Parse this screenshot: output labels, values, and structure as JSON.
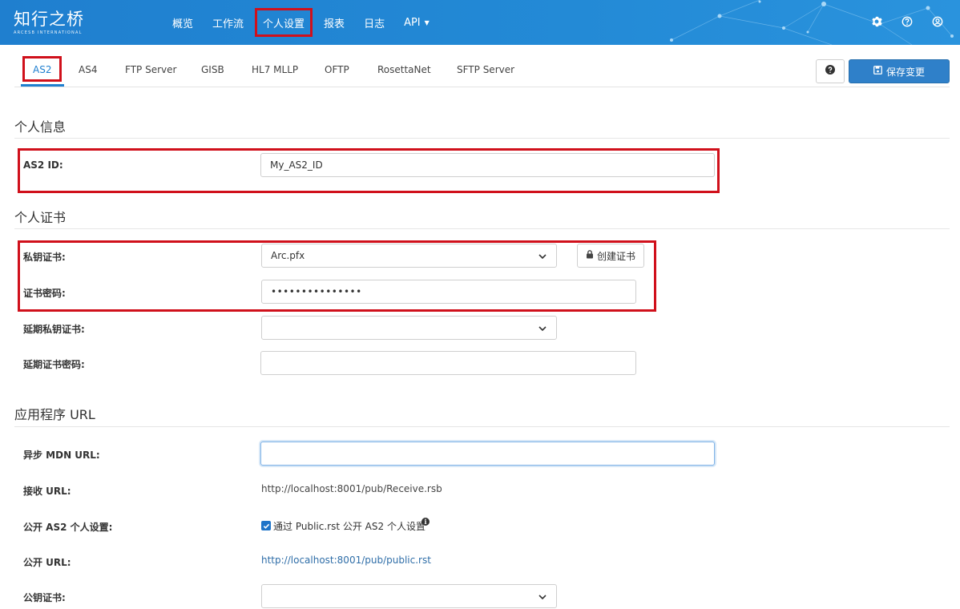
{
  "brand": {
    "name": "知行之桥",
    "tagline": "ARCESB INTERNATIONAL"
  },
  "nav": {
    "items": [
      "概览",
      "工作流",
      "个人设置",
      "报表",
      "日志",
      "API"
    ],
    "active": "个人设置"
  },
  "top_icons": [
    "gear-icon",
    "help-circle-icon",
    "user-circle-icon"
  ],
  "tabs": {
    "items": [
      "AS2",
      "AS4",
      "FTP Server",
      "GISB",
      "HL7 MLLP",
      "OFTP",
      "RosettaNet",
      "SFTP Server"
    ],
    "active": "AS2"
  },
  "toolbar": {
    "save_label": "保存变更"
  },
  "personal_info": {
    "title": "个人信息",
    "as2_id_label": "AS2 ID:",
    "as2_id_value": "My_AS2_ID"
  },
  "personal_cert": {
    "title": "个人证书",
    "private_cert_label": "私钥证书:",
    "private_cert_value": "Arc.pfx",
    "create_cert_label": "创建证书",
    "cert_password_label": "证书密码:",
    "cert_password_value": "•••••••••••••••",
    "future_private_cert_label": "延期私钥证书:",
    "future_private_cert_value": "",
    "future_cert_password_label": "延期证书密码:",
    "future_cert_password_value": ""
  },
  "app_url": {
    "title": "应用程序 URL",
    "async_mdn_label": "异步 MDN URL:",
    "async_mdn_value": "",
    "receive_label": "接收 URL:",
    "receive_value": "http://localhost:8001/pub/Receive.rsb",
    "public_label": "公开 AS2 个人设置:",
    "public_checkbox_label": "通过 Public.rst 公开 AS2 个人设置",
    "public_checked": true,
    "public_url_label": "公开 URL:",
    "public_url_value": "http://localhost:8001/pub/public.rst",
    "public_cert_label": "公钥证书:",
    "public_cert_value": ""
  },
  "colors": {
    "primary": "#1f7fcf",
    "highlight": "#d0101b",
    "button": "#2f80c9",
    "link": "#2f6ea8"
  }
}
